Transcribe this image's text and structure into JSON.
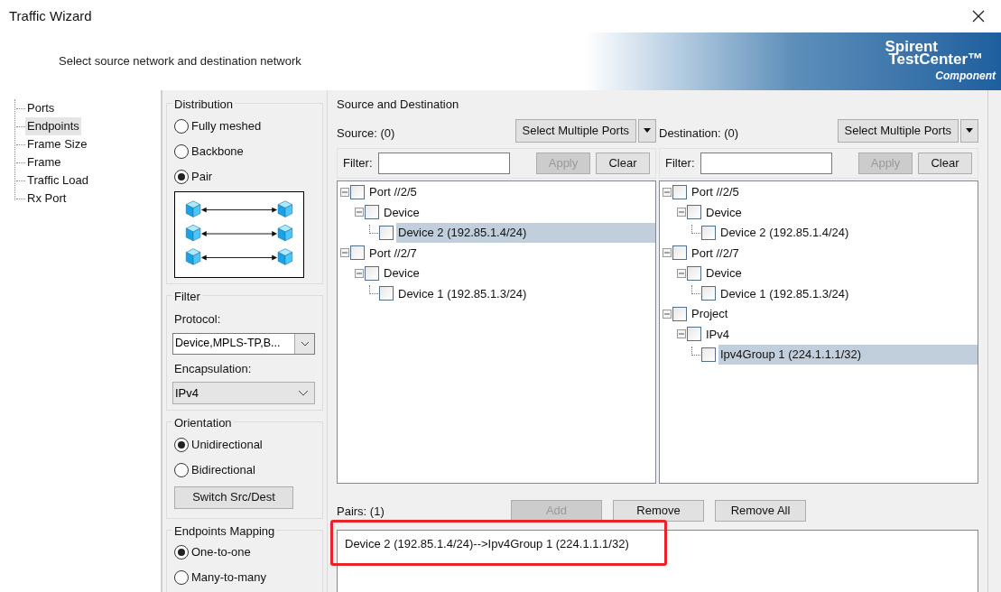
{
  "window": {
    "title": "Traffic Wizard"
  },
  "header": {
    "instruction": "Select source network and destination network",
    "brand": {
      "name_line_1": "Spirent",
      "name_line_2": "TestCenter™",
      "tagline": "Component"
    }
  },
  "nav": {
    "items": [
      {
        "label": "Ports",
        "selected": false
      },
      {
        "label": "Endpoints",
        "selected": true
      },
      {
        "label": "Frame Size",
        "selected": false
      },
      {
        "label": "Frame",
        "selected": false
      },
      {
        "label": "Traffic Load",
        "selected": false
      },
      {
        "label": "Rx Port",
        "selected": false
      }
    ]
  },
  "distribution": {
    "title": "Distribution",
    "options": [
      {
        "label": "Fully meshed",
        "selected": false
      },
      {
        "label": "Backbone",
        "selected": false
      },
      {
        "label": "Pair",
        "selected": true
      }
    ]
  },
  "filter": {
    "title": "Filter",
    "protocol_label": "Protocol:",
    "protocol_value": "Device,MPLS-TP,B...",
    "encapsulation_label": "Encapsulation:",
    "encapsulation_value": "IPv4"
  },
  "orientation": {
    "title": "Orientation",
    "options": [
      {
        "label": "Unidirectional",
        "selected": true
      },
      {
        "label": "Bidirectional",
        "selected": false
      }
    ],
    "button": "Switch Src/Dest"
  },
  "mapping": {
    "title": "Endpoints Mapping",
    "options": [
      {
        "label": "One-to-one",
        "selected": true
      },
      {
        "label": "Many-to-many",
        "selected": false
      }
    ]
  },
  "source_destination": {
    "title": "Source and Destination",
    "panels": [
      {
        "label": "Source: (0)",
        "select_button": "Select Multiple Ports",
        "filter_label": "Filter:",
        "apply": {
          "label": "Apply",
          "disabled": true
        },
        "clear": "Clear",
        "tree": [
          {
            "label": "Port //2/5",
            "checked": false,
            "expanded": true,
            "selected": false,
            "children": [
              {
                "label": "Device",
                "checked": false,
                "expanded": true,
                "selected": false,
                "children": [
                  {
                    "label": "Device 2 (192.85.1.4/24)",
                    "checked": false,
                    "selected": true
                  }
                ]
              }
            ]
          },
          {
            "label": "Port //2/7",
            "checked": false,
            "expanded": true,
            "selected": false,
            "children": [
              {
                "label": "Device",
                "checked": false,
                "expanded": true,
                "selected": false,
                "children": [
                  {
                    "label": "Device 1 (192.85.1.3/24)",
                    "checked": false,
                    "selected": false
                  }
                ]
              }
            ]
          }
        ]
      },
      {
        "label": "Destination: (0)",
        "select_button": "Select Multiple Ports",
        "filter_label": "Filter:",
        "apply": {
          "label": "Apply",
          "disabled": true
        },
        "clear": "Clear",
        "tree": [
          {
            "label": "Port //2/5",
            "checked": false,
            "expanded": true,
            "selected": false,
            "children": [
              {
                "label": "Device",
                "checked": false,
                "expanded": true,
                "selected": false,
                "children": [
                  {
                    "label": "Device 2 (192.85.1.4/24)",
                    "checked": false,
                    "selected": false
                  }
                ]
              }
            ]
          },
          {
            "label": "Port //2/7",
            "checked": false,
            "expanded": true,
            "selected": false,
            "children": [
              {
                "label": "Device",
                "checked": false,
                "expanded": true,
                "selected": false,
                "children": [
                  {
                    "label": "Device 1 (192.85.1.3/24)",
                    "checked": false,
                    "selected": false
                  }
                ]
              }
            ]
          },
          {
            "label": "Project",
            "checked": false,
            "expanded": true,
            "selected": false,
            "children": [
              {
                "label": "IPv4",
                "checked": false,
                "expanded": true,
                "selected": false,
                "children": [
                  {
                    "label": "Ipv4Group 1 (224.1.1.1/32)",
                    "checked": false,
                    "selected": true
                  }
                ]
              }
            ]
          }
        ]
      }
    ]
  },
  "pairs": {
    "label": "Pairs: (1)",
    "buttons": [
      {
        "label": "Add",
        "disabled": true
      },
      {
        "label": "Remove",
        "disabled": false
      },
      {
        "label": "Remove All",
        "disabled": false
      }
    ],
    "items": [
      "Device 2 (192.85.1.4/24)-->Ipv4Group 1 (224.1.1.1/32)"
    ],
    "highlighted": true
  }
}
